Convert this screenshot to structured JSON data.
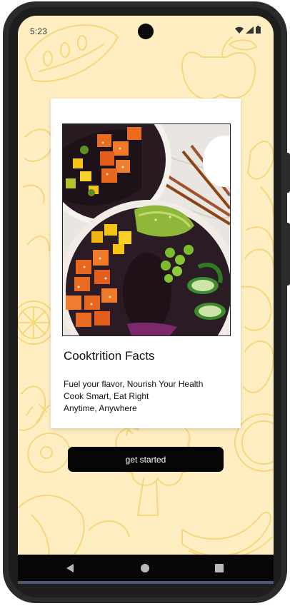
{
  "status_bar": {
    "time": "5:23",
    "icons": [
      "wifi-icon",
      "signal-icon",
      "battery-icon"
    ]
  },
  "card": {
    "image": "poke-bowl-photo",
    "title": "Cooktrition Facts",
    "lines": [
      "Fuel your flavor, Nourish Your Health",
      "Cook Smart, Eat Right",
      "Anytime, Anywhere"
    ]
  },
  "actions": {
    "get_started_label": "get started"
  },
  "nav": {
    "buttons": [
      "back-icon",
      "home-icon",
      "recents-icon"
    ]
  },
  "colors": {
    "screen_background": "#ffeec2",
    "doodle_stroke": "#f7d77c",
    "button_background": "#060606",
    "button_text": "#ffffff"
  }
}
